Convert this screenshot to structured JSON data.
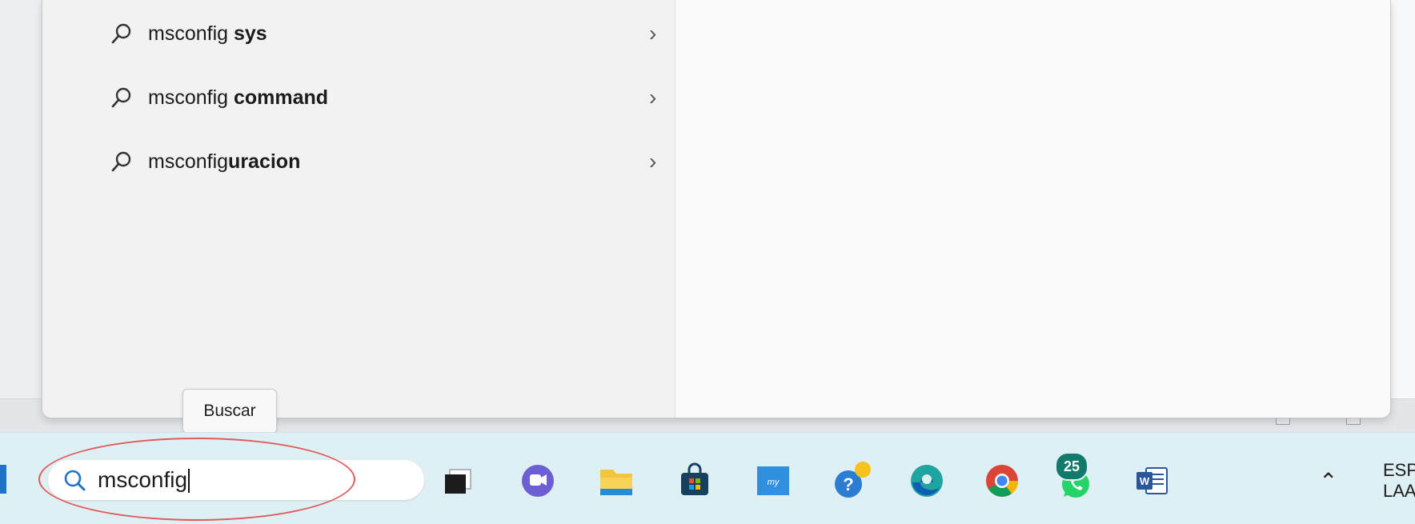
{
  "suggestions": [
    {
      "prefix": "msconfig ",
      "bold": "sys"
    },
    {
      "prefix": "msconfig ",
      "bold": "command"
    },
    {
      "prefix": "msconfig",
      "bold": "uracion"
    }
  ],
  "tooltip": "Buscar",
  "search": {
    "value": "msconfig"
  },
  "taskbar": {
    "badge_count": "25",
    "icons": [
      "task-view-icon",
      "teams-chat-icon",
      "file-explorer-icon",
      "microsoft-store-icon",
      "myapp-icon",
      "help-icon",
      "edge-icon",
      "chrome-icon",
      "whatsapp-icon",
      "word-icon"
    ]
  },
  "tray": {
    "language_line1": "ESP",
    "language_line2": "LAA"
  },
  "colors": {
    "accent": "#1e73c8",
    "annotation": "#e05a5a",
    "taskbar": "#dff0f4"
  }
}
